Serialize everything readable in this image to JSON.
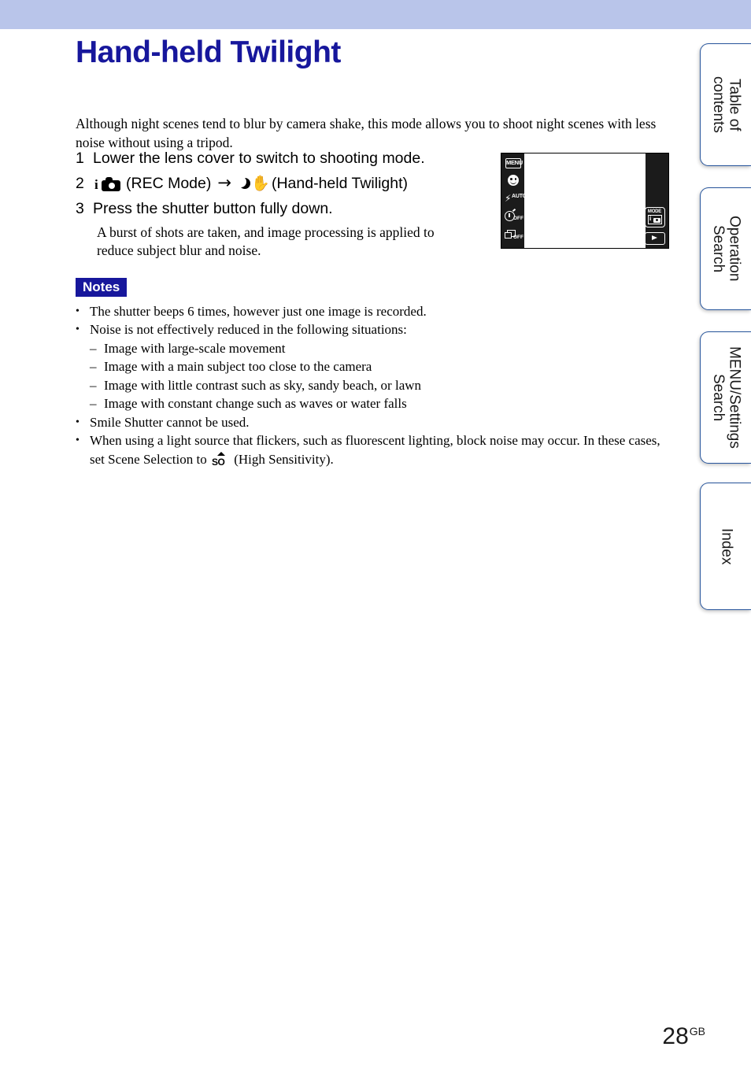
{
  "page": {
    "title": "Hand-held Twilight",
    "title_color": "#17179c",
    "band_color": "#b9c5ea",
    "number": "28",
    "number_suffix": "GB"
  },
  "intro": {
    "text": "Although night scenes tend to blur by camera shake, this mode allows you to shoot night scenes with less noise without using a tripod."
  },
  "steps": [
    {
      "num": "1",
      "text": "Lower the lens cover to switch to shooting mode."
    },
    {
      "num": "2",
      "icon_rec": "rec-mode-icon",
      "label_rec": "(REC Mode)",
      "arrow": "→",
      "icon_twilight": "hand-held-twilight-icon",
      "label_twilight": "(Hand-held Twilight)"
    },
    {
      "num": "3",
      "text": "Press the shutter button fully down.",
      "detail": "A burst of shots are taken, and image processing is applied to reduce subject blur and noise."
    }
  ],
  "lcd": {
    "left_icons": [
      {
        "name": "menu-icon",
        "label": "MENU"
      },
      {
        "name": "smile-shutter-icon",
        "label": ""
      },
      {
        "name": "flash-auto-icon",
        "label": "AUTO"
      },
      {
        "name": "self-timer-off-icon",
        "label": "OFF"
      },
      {
        "name": "burst-off-icon",
        "label": "OFF"
      }
    ],
    "right_buttons": [
      {
        "name": "rec-mode-button",
        "label": "MODE"
      },
      {
        "name": "playback-button",
        "label": "play"
      }
    ]
  },
  "notes": {
    "badge": "Notes",
    "items": [
      {
        "text": "The shutter beeps 6 times, however just one image is recorded.",
        "sub": []
      },
      {
        "text": "Noise is not effectively reduced in the following situations:",
        "sub": [
          "Image with large-scale movement",
          "Image with a main subject too close to the camera",
          "Image with little contrast such as sky, sandy beach, or lawn",
          "Image with constant change such as waves or water falls"
        ]
      },
      {
        "text": "Smile Shutter cannot be used.",
        "sub": []
      }
    ],
    "last_item": {
      "text_before": "When using a light source that flickers, such as fluorescent lighting, block noise may occur. In these cases, set Scene Selection to ",
      "icon": "high-sensitivity-iso-icon",
      "icon_text": "SO",
      "text_after": " (High Sensitivity)."
    }
  },
  "tabs": [
    {
      "name": "tab-table-of-contents",
      "label": "Table of\ncontents"
    },
    {
      "name": "tab-operation-search",
      "label": "Operation\nSearch"
    },
    {
      "name": "tab-menu-settings-search",
      "label": "MENU/Settings\nSearch"
    },
    {
      "name": "tab-index",
      "label": "Index"
    }
  ]
}
